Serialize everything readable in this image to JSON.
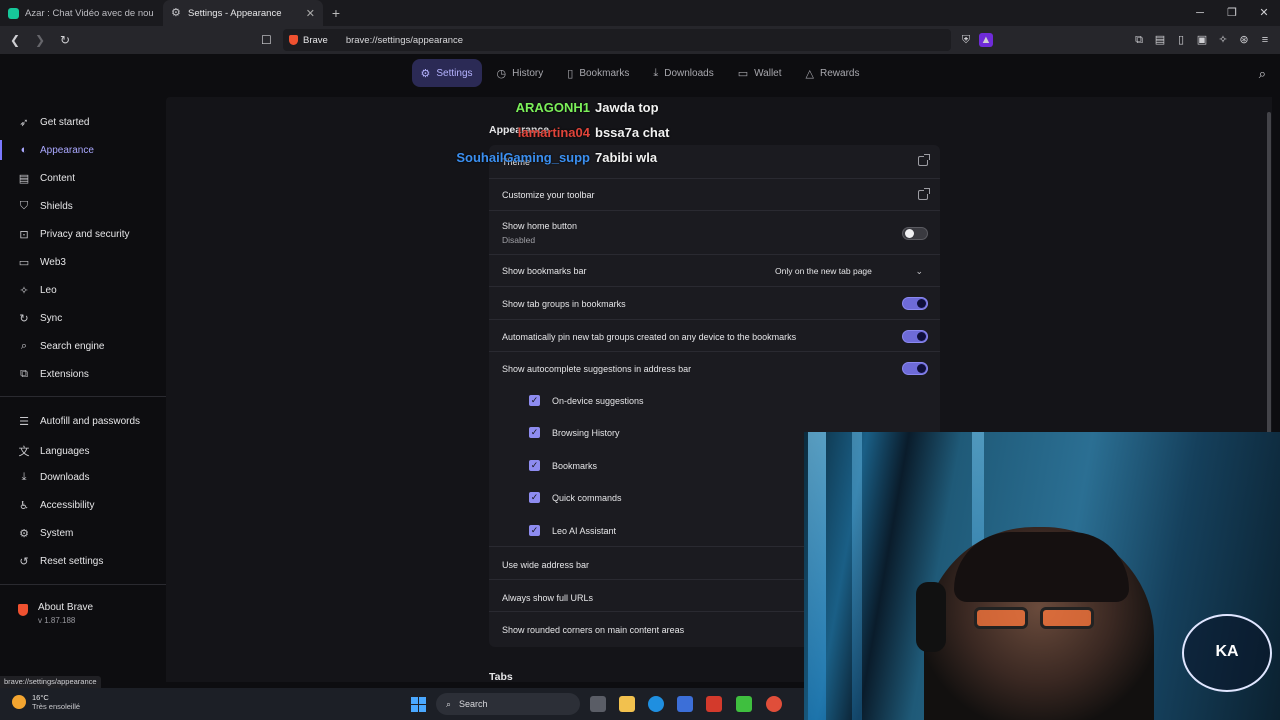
{
  "tabs": [
    {
      "title": "Azar : Chat Vidéo avec de nouvelles ...",
      "active": false
    },
    {
      "title": "Settings - Appearance",
      "active": true
    }
  ],
  "address": {
    "chip": "Brave",
    "url": "brave://settings/appearance"
  },
  "settings_nav": [
    {
      "label": "Settings",
      "icon": "gear-icon",
      "active": true
    },
    {
      "label": "History",
      "icon": "clock-icon"
    },
    {
      "label": "Bookmarks",
      "icon": "bookmark-icon"
    },
    {
      "label": "Downloads",
      "icon": "download-icon"
    },
    {
      "label": "Wallet",
      "icon": "wallet-icon"
    },
    {
      "label": "Rewards",
      "icon": "rewards-icon"
    }
  ],
  "sidebar": {
    "items": [
      {
        "label": "Get started",
        "icon": "rocket-icon"
      },
      {
        "label": "Appearance",
        "icon": "palette-icon",
        "active": true
      },
      {
        "label": "Content",
        "icon": "content-icon"
      },
      {
        "label": "Shields",
        "icon": "shield-icon"
      },
      {
        "label": "Privacy and security",
        "icon": "lock-icon"
      },
      {
        "label": "Web3",
        "icon": "web3-icon"
      },
      {
        "label": "Leo",
        "icon": "leo-icon"
      },
      {
        "label": "Sync",
        "icon": "sync-icon"
      },
      {
        "label": "Search engine",
        "icon": "search-icon"
      },
      {
        "label": "Extensions",
        "icon": "puzzle-icon"
      },
      {
        "label": "Autofill and passwords",
        "icon": "autofill-icon"
      },
      {
        "label": "Languages",
        "icon": "language-icon"
      },
      {
        "label": "Downloads",
        "icon": "download-icon"
      },
      {
        "label": "Accessibility",
        "icon": "accessibility-icon"
      },
      {
        "label": "System",
        "icon": "system-icon"
      },
      {
        "label": "Reset settings",
        "icon": "reset-icon"
      }
    ],
    "about": {
      "title": "About Brave",
      "version": "v 1.87.188"
    }
  },
  "main": {
    "section_title": "Appearance",
    "theme_label": "Theme",
    "rows": {
      "customize_toolbar": "Customize your toolbar",
      "home_button": "Show home button",
      "home_button_sub": "Disabled",
      "bookmarks_bar": "Show bookmarks bar",
      "bookmarks_bar_value": "Only on the new tab page",
      "tab_groups": "Show tab groups in bookmarks",
      "pin_tab_groups": "Automatically pin new tab groups created on any device to the bookmarks",
      "autocomplete": "Show autocomplete suggestions in address bar",
      "on_device": "On-device suggestions",
      "browsing_history": "Browsing History",
      "bookmarks": "Bookmarks",
      "quick_commands": "Quick commands",
      "leo_ai": "Leo AI Assistant",
      "wide_address_bar": "Use wide address bar",
      "full_urls": "Always show full URLs",
      "rounded_corners": "Show rounded corners on main content areas"
    },
    "tabs_title": "Tabs"
  },
  "chat": [
    {
      "name": "ARAGONH1",
      "msg": "Jawda top",
      "color": "#7cf05a"
    },
    {
      "name": "lamartina04",
      "msg": "bssa7a chat",
      "color": "#e0443a"
    },
    {
      "name": "SouhailGaming_supp",
      "msg": "7abibi wla",
      "color": "#3b8ff0"
    }
  ],
  "status_url": "brave://settings/appearance",
  "weather": {
    "temp": "16°C",
    "desc": "Très ensoleillé"
  },
  "taskbar": {
    "search_label": "Search"
  }
}
